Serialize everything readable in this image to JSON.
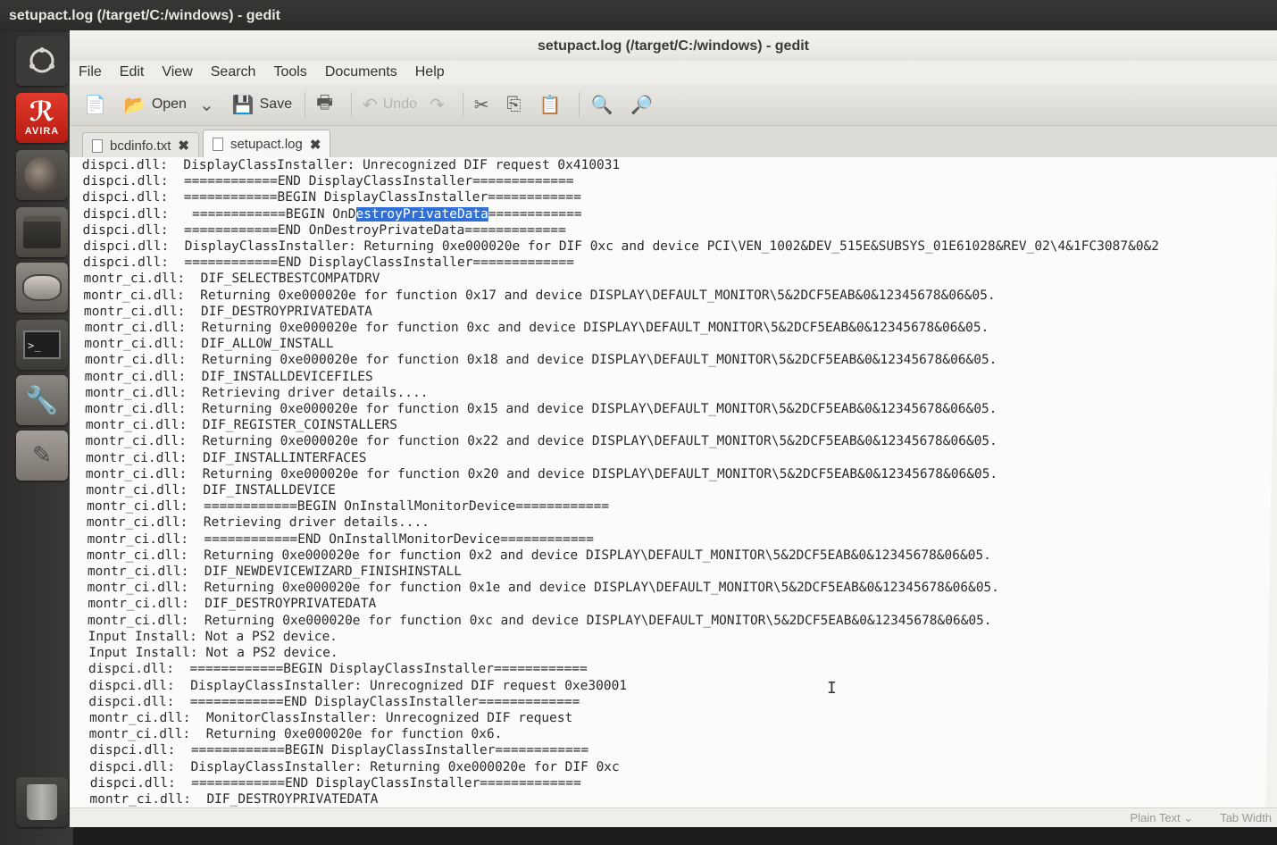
{
  "system": {
    "top_title": "setupact.log (/target/C:/windows) - gedit"
  },
  "launcher": {
    "avira_label": "AVIRA",
    "items": [
      "dash-icon",
      "avira-icon",
      "firefox-icon",
      "files-icon",
      "disk-icon",
      "terminal-icon",
      "settings-icon",
      "text-editor-icon",
      "trash-icon"
    ]
  },
  "window": {
    "title": "setupact.log (/target/C:/windows) - gedit",
    "menu": [
      "File",
      "Edit",
      "View",
      "Search",
      "Tools",
      "Documents",
      "Help"
    ],
    "toolbar": {
      "open_label": "Open",
      "save_label": "Save",
      "undo_label": "Undo"
    },
    "tabs": [
      {
        "label": "bcdinfo.txt"
      },
      {
        "label": "setupact.log"
      }
    ],
    "status": {
      "language": "Plain Text ⌄",
      "tab_width": "Tab Width"
    }
  },
  "editor": {
    "selection_prefix": "dispci.dll:   ============BEGIN OnD",
    "selection_text": "estroyPrivateData",
    "selection_suffix": "============",
    "lines": [
      "dispci.dll:  DisplayClassInstaller: Unrecognized DIF request 0x410031",
      "dispci.dll:  ============END DisplayClassInstaller=============",
      "dispci.dll:  ============BEGIN DisplayClassInstaller============",
      "__SELECTED__",
      "dispci.dll:  ============END OnDestroyPrivateData=============",
      "dispci.dll:  DisplayClassInstaller: Returning 0xe000020e for DIF 0xc and device PCI\\VEN_1002&DEV_515E&SUBSYS_01E61028&REV_02\\4&1FC3087&0&2",
      "dispci.dll:  ============END DisplayClassInstaller=============",
      "montr_ci.dll:  DIF_SELECTBESTCOMPATDRV",
      "montr_ci.dll:  Returning 0xe000020e for function 0x17 and device DISPLAY\\DEFAULT_MONITOR\\5&2DCF5EAB&0&12345678&06&05.",
      "montr_ci.dll:  DIF_DESTROYPRIVATEDATA",
      "montr_ci.dll:  Returning 0xe000020e for function 0xc and device DISPLAY\\DEFAULT_MONITOR\\5&2DCF5EAB&0&12345678&06&05.",
      "montr_ci.dll:  DIF_ALLOW_INSTALL",
      "montr_ci.dll:  Returning 0xe000020e for function 0x18 and device DISPLAY\\DEFAULT_MONITOR\\5&2DCF5EAB&0&12345678&06&05.",
      "montr_ci.dll:  DIF_INSTALLDEVICEFILES",
      "montr_ci.dll:  Retrieving driver details....",
      "montr_ci.dll:  Returning 0xe000020e for function 0x15 and device DISPLAY\\DEFAULT_MONITOR\\5&2DCF5EAB&0&12345678&06&05.",
      "montr_ci.dll:  DIF_REGISTER_COINSTALLERS",
      "montr_ci.dll:  Returning 0xe000020e for function 0x22 and device DISPLAY\\DEFAULT_MONITOR\\5&2DCF5EAB&0&12345678&06&05.",
      "montr_ci.dll:  DIF_INSTALLINTERFACES",
      "montr_ci.dll:  Returning 0xe000020e for function 0x20 and device DISPLAY\\DEFAULT_MONITOR\\5&2DCF5EAB&0&12345678&06&05.",
      "montr_ci.dll:  DIF_INSTALLDEVICE",
      "montr_ci.dll:  ============BEGIN OnInstallMonitorDevice============",
      "montr_ci.dll:  Retrieving driver details....",
      "montr_ci.dll:  ============END OnInstallMonitorDevice============",
      "montr_ci.dll:  Returning 0xe000020e for function 0x2 and device DISPLAY\\DEFAULT_MONITOR\\5&2DCF5EAB&0&12345678&06&05.",
      "montr_ci.dll:  DIF_NEWDEVICEWIZARD_FINISHINSTALL",
      "montr_ci.dll:  Returning 0xe000020e for function 0x1e and device DISPLAY\\DEFAULT_MONITOR\\5&2DCF5EAB&0&12345678&06&05.",
      "montr_ci.dll:  DIF_DESTROYPRIVATEDATA",
      "montr_ci.dll:  Returning 0xe000020e for function 0xc and device DISPLAY\\DEFAULT_MONITOR\\5&2DCF5EAB&0&12345678&06&05.",
      "Input Install: Not a PS2 device.",
      "Input Install: Not a PS2 device.",
      "dispci.dll:  ============BEGIN DisplayClassInstaller============",
      "dispci.dll:  DisplayClassInstaller: Unrecognized DIF request 0xe30001",
      "dispci.dll:  ============END DisplayClassInstaller=============",
      "montr_ci.dll:  MonitorClassInstaller: Unrecognized DIF request",
      "montr_ci.dll:  Returning 0xe000020e for function 0x6.",
      "dispci.dll:  ============BEGIN DisplayClassInstaller============",
      "dispci.dll:  DisplayClassInstaller: Returning 0xe000020e for DIF 0xc",
      "dispci.dll:  ============END DisplayClassInstaller=============",
      "montr_ci.dll:  DIF_DESTROYPRIVATEDATA"
    ]
  }
}
